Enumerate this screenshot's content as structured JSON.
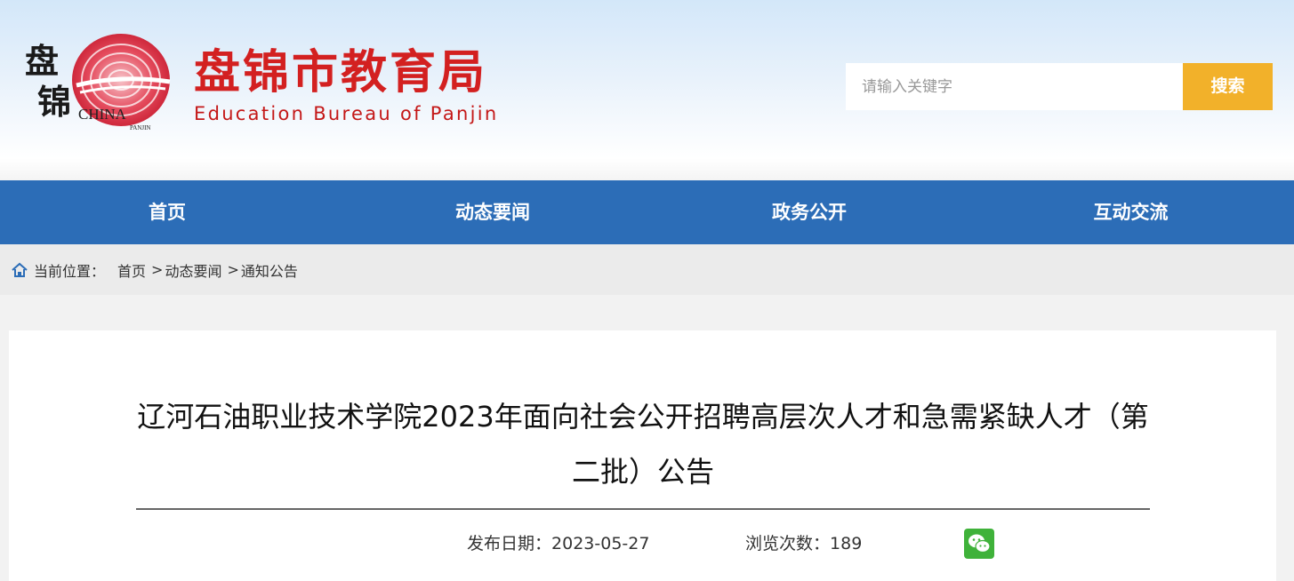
{
  "header": {
    "logo_text": "盘锦",
    "logo_sub": "CHINA",
    "logo_sub2": "PANJIN",
    "site_name": "盘锦市教育局",
    "site_name_en": "Education Bureau of Panjin"
  },
  "search": {
    "placeholder": "请输入关键字",
    "button_label": "搜索"
  },
  "nav": {
    "items": [
      {
        "label": "首页"
      },
      {
        "label": "动态要闻"
      },
      {
        "label": "政务公开"
      },
      {
        "label": "互动交流"
      }
    ]
  },
  "breadcrumb": {
    "label": "当前位置：",
    "items": [
      "首页",
      "动态要闻",
      "通知公告"
    ],
    "separator": ">"
  },
  "article": {
    "title": "辽河石油职业技术学院2023年面向社会公开招聘高层次人才和急需紧缺人才（第二批）公告",
    "date_label": "发布日期：",
    "date": "2023-05-27",
    "views_label": "浏览次数：",
    "views": "189"
  },
  "colors": {
    "nav_bg": "#2c6db7",
    "brand_red": "#d32020",
    "search_button": "#f2b12a",
    "wechat_green": "#3fb23a"
  }
}
